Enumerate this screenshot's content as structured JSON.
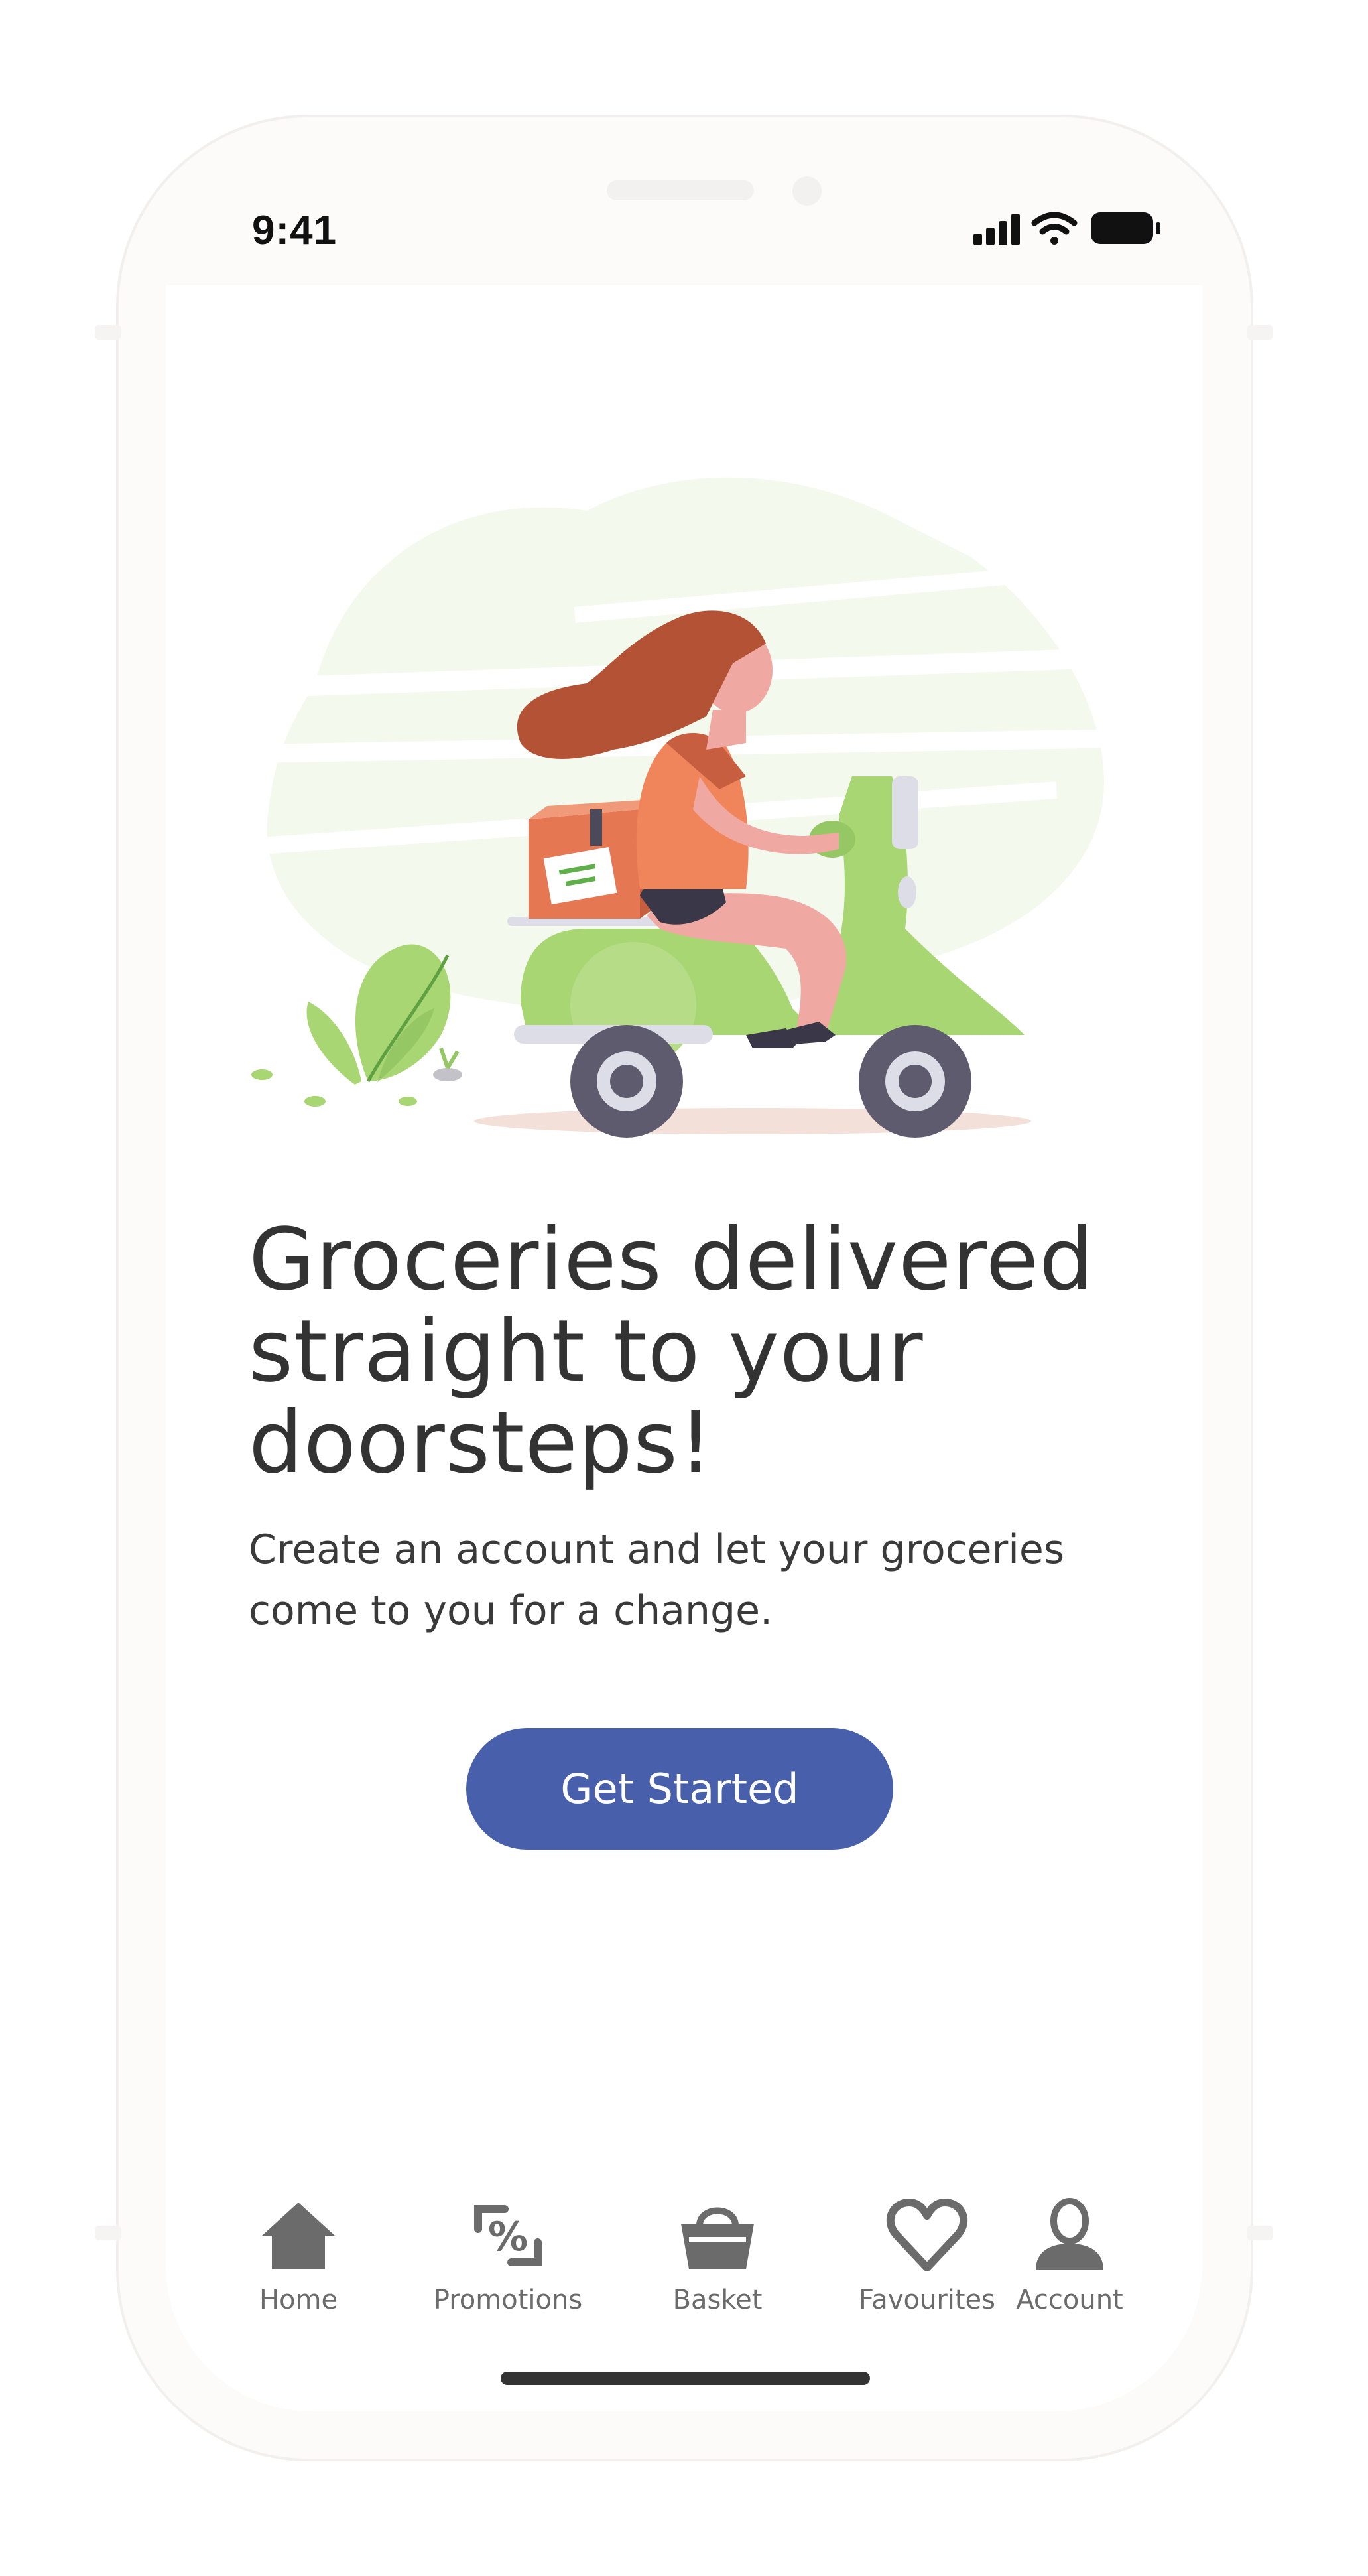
{
  "status_bar": {
    "time": "9:41",
    "icons": [
      "cellular-signal-icon",
      "wifi-icon",
      "battery-icon"
    ]
  },
  "hero": {
    "illustration": "delivery-scooter-illustration"
  },
  "content": {
    "headline_line1": "Groceries delivered",
    "headline_line2": "straight to your",
    "headline_line3": "doorsteps!",
    "subtext_line1": "Create an account and let your groceries",
    "subtext_line2": "come to you for a change."
  },
  "cta": {
    "label": "Get Started",
    "color": "#4860ab"
  },
  "tabbar": {
    "items": [
      {
        "label": "Home",
        "icon": "home-icon"
      },
      {
        "label": "Promotions",
        "icon": "promotions-icon"
      },
      {
        "label": "Basket",
        "icon": "basket-icon"
      },
      {
        "label": "Favourites",
        "icon": "heart-icon"
      },
      {
        "label": "Account",
        "icon": "account-icon"
      }
    ]
  },
  "colors": {
    "accent": "#4860ab",
    "illustration_green": "#a8d672",
    "illustration_orange": "#e67753",
    "tab_icon": "#6b6b6b"
  }
}
